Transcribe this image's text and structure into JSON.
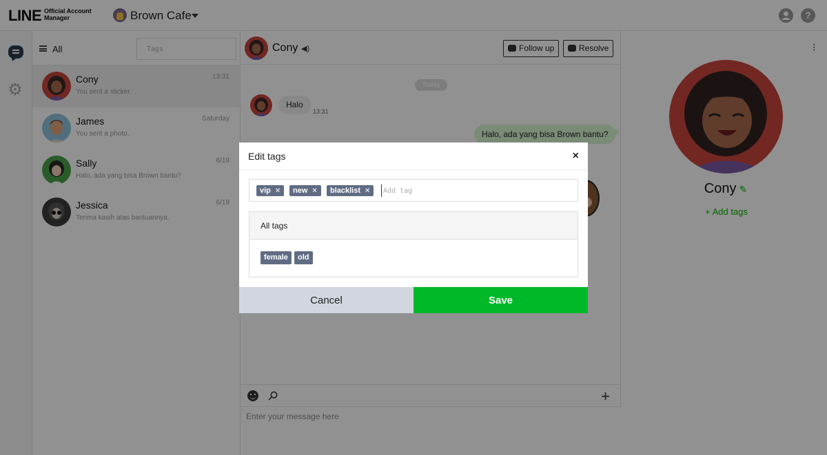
{
  "header": {
    "logo_main": "LINE",
    "logo_sub": "Official Account Manager",
    "account_name": "Brown Cafe",
    "account_icon": "brown-cafe-icon",
    "user_icon": "user-circle-icon",
    "help_label": "?"
  },
  "rail": {
    "items": [
      "chat-icon",
      "gear-icon"
    ]
  },
  "list": {
    "filter_label": "All",
    "tag_placeholder": "Tags",
    "chats": [
      {
        "name": "Cony",
        "message": "You sent a sticker.",
        "time": "13:31",
        "active": true
      },
      {
        "name": "James",
        "message": "You sent a photo.",
        "time": "Saturday"
      },
      {
        "name": "Sally",
        "message": "Halo, ada yang bisa Brown bantu?",
        "time": "6/19"
      },
      {
        "name": "Jessica",
        "message": "Terima kasih atas bantuannya.",
        "time": "6/19"
      }
    ]
  },
  "chat": {
    "title": "Cony",
    "follow_up_label": "Follow up",
    "resolve_label": "Resolve",
    "date_label": "Today",
    "incoming": {
      "text": "Halo",
      "time": "13:31"
    },
    "outgoing": {
      "text": "Halo, ada yang bisa Brown bantu?"
    },
    "composer_placeholder": "Enter your message here"
  },
  "profile": {
    "name": "Cony",
    "add_tags_label": "+ Add tags"
  },
  "modal": {
    "title": "Edit tags",
    "close_label": "×",
    "selected_tags": [
      "vip",
      "new",
      "blacklist"
    ],
    "input_placeholder": "Add tag",
    "all_tags_label": "All tags",
    "available_tags": [
      "female",
      "old"
    ],
    "cancel_label": "Cancel",
    "save_label": "Save"
  },
  "colors": {
    "brand_green": "#00b928",
    "tag_chip": "#606c83",
    "cancel_bg": "#d2d7df"
  }
}
